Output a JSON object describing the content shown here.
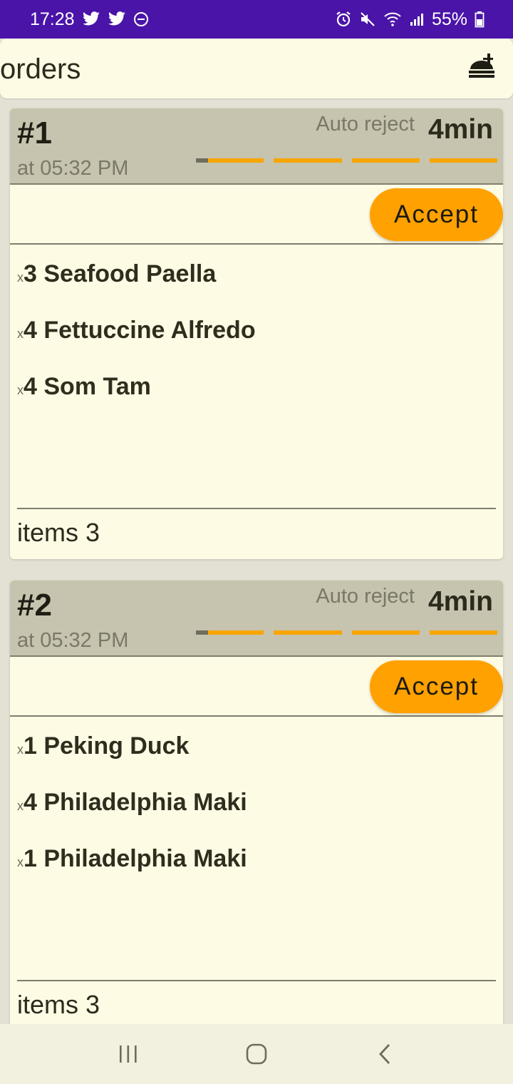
{
  "status_bar": {
    "time": "17:28",
    "battery": "55%",
    "left_icons": [
      "twitter-icon",
      "twitter-icon",
      "do-not-disturb-icon"
    ],
    "right_icons": [
      "alarm-icon",
      "mute-icon",
      "wifi-icon",
      "signal-icon",
      "battery-icon"
    ]
  },
  "app_bar": {
    "title": "orders",
    "icon": "food-icon"
  },
  "orders": [
    {
      "number": "#1",
      "time": "at 05:32 PM",
      "auto_reject_label": "Auto reject",
      "minutes": "4min",
      "timer_progress": 0.04,
      "accept_label": "Accept",
      "items": [
        {
          "x": "x",
          "qty": "3",
          "name": "Seafood Paella"
        },
        {
          "x": "x",
          "qty": "4",
          "name": "Fettuccine Alfredo"
        },
        {
          "x": "x",
          "qty": "4",
          "name": "Som Tam"
        }
      ],
      "summary": "items 3"
    },
    {
      "number": "#2",
      "time": "at 05:32 PM",
      "auto_reject_label": "Auto reject",
      "minutes": "4min",
      "timer_progress": 0.04,
      "accept_label": "Accept",
      "items": [
        {
          "x": "x",
          "qty": "1",
          "name": "Peking Duck"
        },
        {
          "x": "x",
          "qty": "4",
          "name": "Philadelphia Maki"
        },
        {
          "x": "x",
          "qty": "1",
          "name": "Philadelphia Maki"
        }
      ],
      "summary": "items 3"
    }
  ],
  "nav_bar": {
    "icons": [
      "recent-apps-icon",
      "home-icon",
      "back-icon"
    ]
  },
  "colors": {
    "status_bar": "#4a14a8",
    "accent": "#ffa100",
    "card_header": "#c6c4ae",
    "card_body": "#fefbe4"
  }
}
